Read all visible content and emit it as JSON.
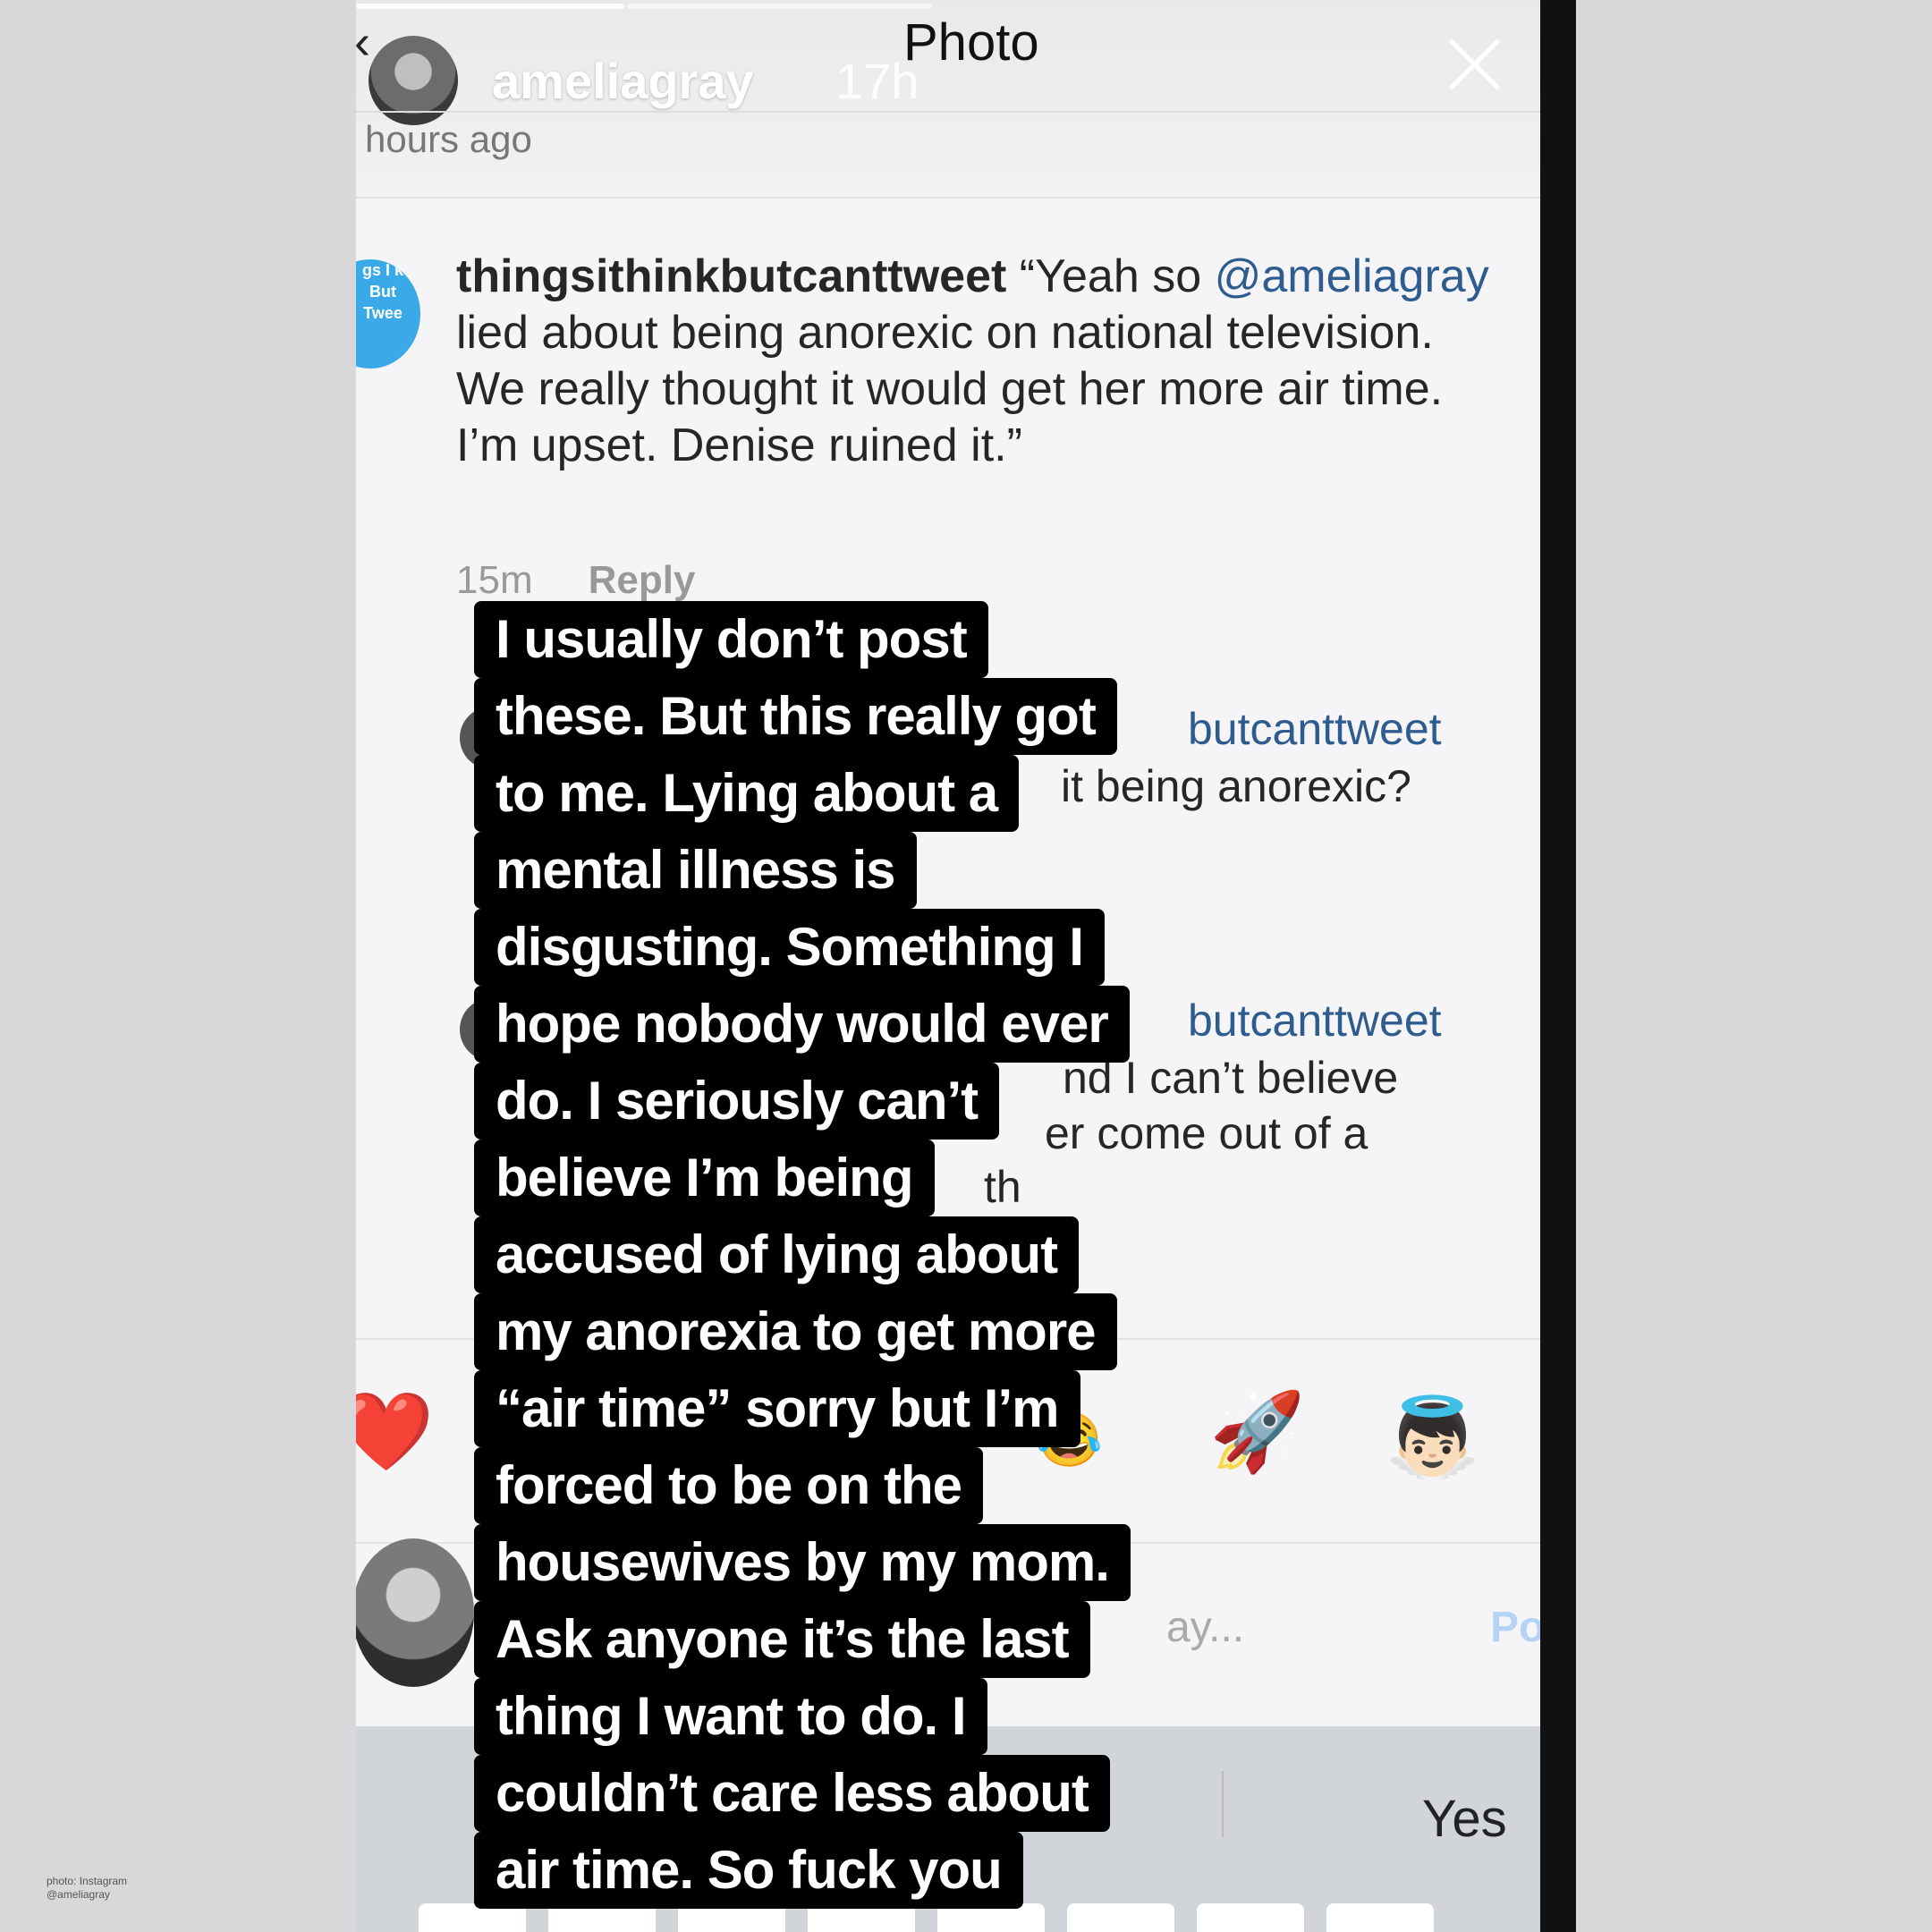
{
  "story": {
    "username": "ameliagray",
    "time": "17h",
    "title": "Photo",
    "subtitle": "hours ago"
  },
  "comment": {
    "username": "thingsithinkbutcanttweet",
    "text_start": " “Yeah so ",
    "mention": "@ameliagray",
    "text_rest": " lied about being anorexic on national television. We really thought it would get her more air time. I’m upset. Denise ruined it.”",
    "time": "15m",
    "reply_label": "Reply",
    "avatar_text": "gs I k But Twee"
  },
  "replies": [
    {
      "line1": "butcanttweet",
      "line2": "it being anorexic?"
    },
    {
      "line1": "butcanttweet",
      "line2": "nd I can’t believe",
      "line3": "er come out of a",
      "line4": "th"
    }
  ],
  "emoji_bar": [
    "❤️",
    "😂",
    "🚀",
    "👼🏻"
  ],
  "composer": {
    "placeholder_tail": "ay...",
    "post_label": "Po"
  },
  "keyboard": {
    "suggestion": "Yes"
  },
  "overlay_lines": [
    "I usually don’t post",
    "these. But this really got",
    "to me. Lying about a",
    "mental illness is",
    "disgusting. Something I",
    "hope nobody would ever",
    "do. I seriously can’t",
    "believe I’m being",
    "accused of lying about",
    "my anorexia to get more",
    "“air time” sorry but I’m",
    "forced to be on the",
    "housewives by my mom.",
    "Ask anyone it’s the last",
    "thing I want to do. I",
    "couldn’t care less about",
    "air time. So fuck you"
  ],
  "credit": [
    "photo: Instagram",
    "@ameliagray"
  ]
}
